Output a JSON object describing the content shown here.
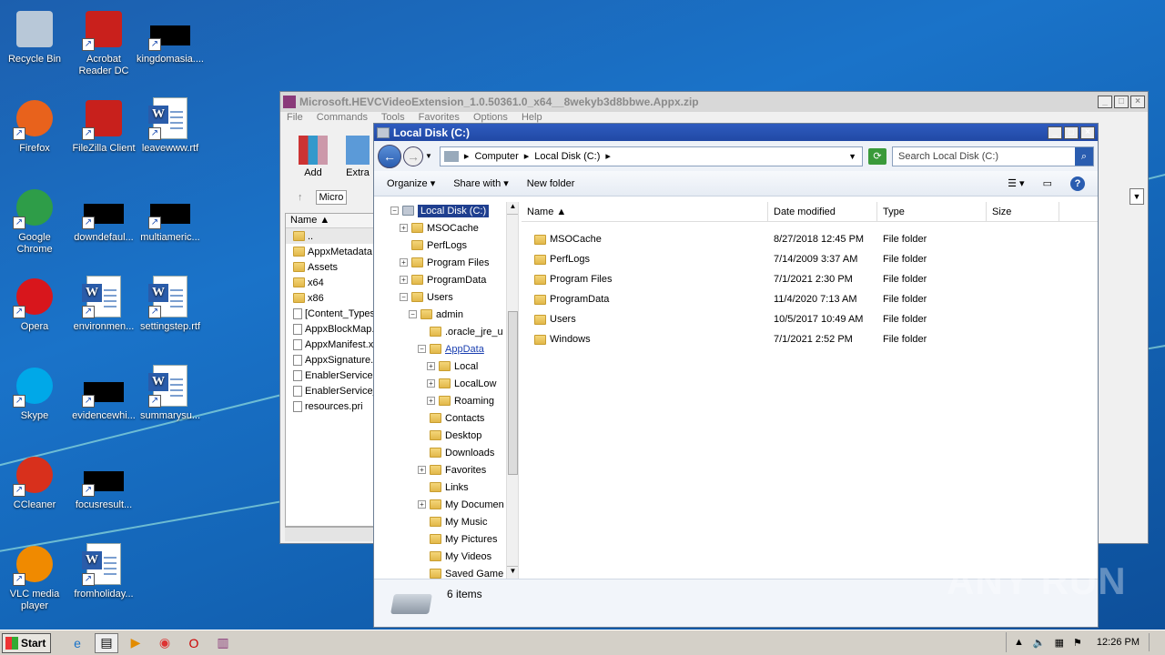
{
  "desktop": {
    "icons": [
      {
        "label": "Recycle Bin",
        "icon": "recycle-bin-icon"
      },
      {
        "label": "Acrobat Reader DC",
        "icon": "acrobat-icon"
      },
      {
        "label": "kingdomasia....",
        "icon": "redacted-file-icon"
      },
      {
        "label": "Firefox",
        "icon": "firefox-icon"
      },
      {
        "label": "FileZilla Client",
        "icon": "filezilla-icon"
      },
      {
        "label": "leavewww.rtf",
        "icon": "word-doc-icon"
      },
      {
        "label": "Google Chrome",
        "icon": "chrome-icon"
      },
      {
        "label": "downdefaul...",
        "icon": "redacted-file-icon"
      },
      {
        "label": "multiameric...",
        "icon": "redacted-file-icon"
      },
      {
        "label": "Opera",
        "icon": "opera-icon"
      },
      {
        "label": "environmen...",
        "icon": "word-doc-icon"
      },
      {
        "label": "settingstep.rtf",
        "icon": "word-doc-icon"
      },
      {
        "label": "Skype",
        "icon": "skype-icon"
      },
      {
        "label": "evidencewhi...",
        "icon": "redacted-file-icon"
      },
      {
        "label": "summarysu...",
        "icon": "word-doc-icon"
      },
      {
        "label": "CCleaner",
        "icon": "ccleaner-icon"
      },
      {
        "label": "focusresult...",
        "icon": "redacted-file-icon"
      },
      {
        "label": "VLC media player",
        "icon": "vlc-icon"
      },
      {
        "label": "fromholiday...",
        "icon": "word-doc-icon"
      }
    ]
  },
  "zip_window": {
    "title": "Microsoft.HEVCVideoExtension_1.0.50361.0_x64__8wekyb3d8bbwe.Appx.zip",
    "menu": [
      "File",
      "Commands",
      "Tools",
      "Favorites",
      "Options",
      "Help"
    ],
    "tool_add": "Add",
    "tool_extract": "Extra",
    "path_value": "Micro",
    "column_name": "Name",
    "files": [
      "..",
      "AppxMetadata",
      "Assets",
      "x64",
      "x86",
      "[Content_Types",
      "AppxBlockMap.",
      "AppxManifest.x",
      "AppxSignature.",
      "EnablerService.",
      "EnablerService_",
      "resources.pri"
    ]
  },
  "explorer": {
    "title": "Local Disk (C:)",
    "breadcrumb": [
      "Computer",
      "Local Disk (C:)"
    ],
    "search_placeholder": "Search Local Disk (C:)",
    "commands": {
      "organize": "Organize",
      "share": "Share with",
      "new_folder": "New folder"
    },
    "tree": [
      {
        "label": "Local Disk (C:)",
        "depth": 0,
        "expander": "−",
        "selected": true
      },
      {
        "label": "MSOCache",
        "depth": 1,
        "expander": "+"
      },
      {
        "label": "PerfLogs",
        "depth": 1,
        "expander": ""
      },
      {
        "label": "Program Files",
        "depth": 1,
        "expander": "+"
      },
      {
        "label": "ProgramData",
        "depth": 1,
        "expander": "+"
      },
      {
        "label": "Users",
        "depth": 1,
        "expander": "−"
      },
      {
        "label": "admin",
        "depth": 2,
        "expander": "−"
      },
      {
        "label": ".oracle_jre_u",
        "depth": 3,
        "expander": ""
      },
      {
        "label": "AppData",
        "depth": 3,
        "expander": "−",
        "link": true
      },
      {
        "label": "Local",
        "depth": 4,
        "expander": "+"
      },
      {
        "label": "LocalLow",
        "depth": 4,
        "expander": "+"
      },
      {
        "label": "Roaming",
        "depth": 4,
        "expander": "+"
      },
      {
        "label": "Contacts",
        "depth": 3,
        "expander": ""
      },
      {
        "label": "Desktop",
        "depth": 3,
        "expander": ""
      },
      {
        "label": "Downloads",
        "depth": 3,
        "expander": ""
      },
      {
        "label": "Favorites",
        "depth": 3,
        "expander": "+"
      },
      {
        "label": "Links",
        "depth": 3,
        "expander": ""
      },
      {
        "label": "My Documen",
        "depth": 3,
        "expander": "+"
      },
      {
        "label": "My Music",
        "depth": 3,
        "expander": ""
      },
      {
        "label": "My Pictures",
        "depth": 3,
        "expander": ""
      },
      {
        "label": "My Videos",
        "depth": 3,
        "expander": ""
      },
      {
        "label": "Saved Game",
        "depth": 3,
        "expander": ""
      }
    ],
    "columns": {
      "name": "Name",
      "date": "Date modified",
      "type": "Type",
      "size": "Size"
    },
    "rows": [
      {
        "name": "MSOCache",
        "date": "8/27/2018 12:45 PM",
        "type": "File folder",
        "size": ""
      },
      {
        "name": "PerfLogs",
        "date": "7/14/2009 3:37 AM",
        "type": "File folder",
        "size": ""
      },
      {
        "name": "Program Files",
        "date": "7/1/2021 2:30 PM",
        "type": "File folder",
        "size": ""
      },
      {
        "name": "ProgramData",
        "date": "11/4/2020 7:13 AM",
        "type": "File folder",
        "size": ""
      },
      {
        "name": "Users",
        "date": "10/5/2017 10:49 AM",
        "type": "File folder",
        "size": ""
      },
      {
        "name": "Windows",
        "date": "7/1/2021 2:52 PM",
        "type": "File folder",
        "size": ""
      }
    ],
    "status": "6 items"
  },
  "taskbar": {
    "start": "Start",
    "clock": "12:26 PM"
  },
  "watermark": "ANY RUN"
}
